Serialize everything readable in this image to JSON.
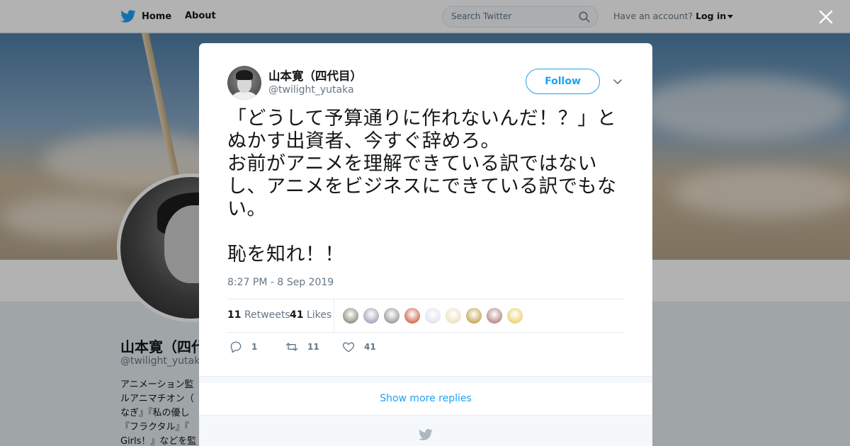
{
  "colors": {
    "brand": "#1da1f2",
    "text": "#14171a",
    "muted": "#657786"
  },
  "topbar": {
    "home_label": "Home",
    "about_label": "About",
    "search_placeholder": "Search Twitter",
    "account_prompt": "Have an account?",
    "login_label": "Log in"
  },
  "profile": {
    "name": "山本寛（四代目）",
    "handle": "@twilight_yutaka",
    "bio_lines": [
      "アニメーション監",
      "ルアニマチオン（",
      "なぎ』『私の優し",
      "『フラクタル』『",
      "Girls！』などを監"
    ]
  },
  "tweet": {
    "author_name": "山本寛（四代目）",
    "author_handle": "@twilight_yutaka",
    "follow_label": "Follow",
    "text": "「どうして予算通りに作れないんだ！？」とぬかす出資者、今すぐ辞めろ。\nお前がアニメを理解できている訳ではないし、アニメをビジネスにできている訳でもない。\n\n恥を知れ！！",
    "timestamp": "8:27 PM - 8 Sep 2019",
    "retweets_count": "11",
    "retweets_label": "Retweets",
    "likes_count": "41",
    "likes_label": "Likes",
    "liker_colors": [
      "#6b6b55",
      "#8a86a0",
      "#7a7a7a",
      "#c23b1a",
      "#d9d9e6",
      "#e8d7b0",
      "#b48a22",
      "#a06060",
      "#e6c34a"
    ],
    "reply_count": "1",
    "retweet_action_count": "11",
    "like_action_count": "41"
  },
  "show_more_label": "Show more replies"
}
